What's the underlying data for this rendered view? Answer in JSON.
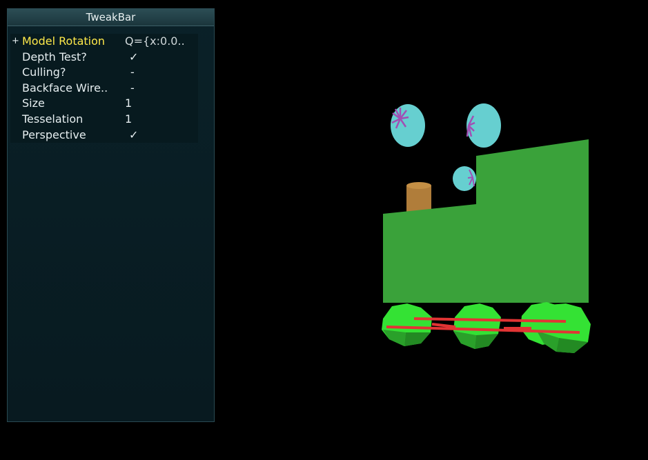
{
  "tweakbar": {
    "title": "TweakBar",
    "expand_symbol": "+",
    "rows": [
      {
        "label": "Model Rotation",
        "value": "Q={x:0.0.."
      },
      {
        "label": "Depth Test?",
        "value": "✓"
      },
      {
        "label": "Culling?",
        "value": "-"
      },
      {
        "label": "Backface Wire..",
        "value": "-"
      },
      {
        "label": "Size",
        "value": "1"
      },
      {
        "label": "Tesselation",
        "value": "1"
      },
      {
        "label": "Perspective",
        "value": "✓"
      }
    ]
  },
  "colors": {
    "background": "#000000",
    "panel": "#0a2128",
    "highlight_label": "#ffe94a",
    "check": "#7dff6a",
    "train_body": "#3aa23a",
    "chimney": "#b07d3a",
    "smoke": "#66cfd0",
    "smoke_swirl": "#a24fb4",
    "wheels": "#34e234",
    "rods": "#e23434"
  }
}
